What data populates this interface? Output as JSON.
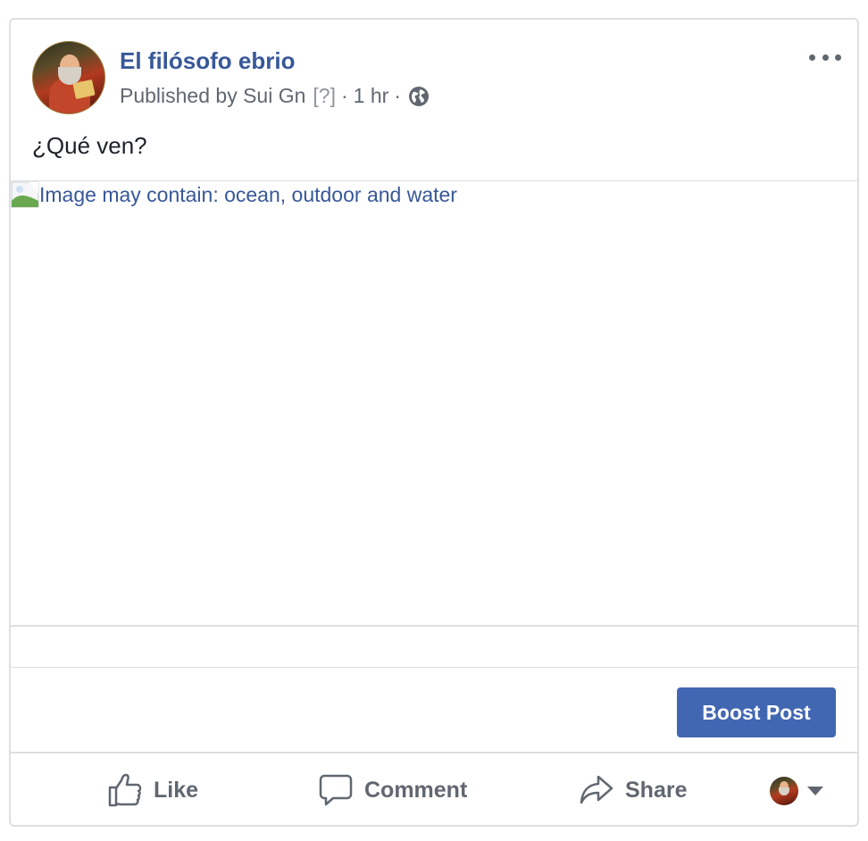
{
  "post": {
    "page_name": "El filósofo ebrio",
    "published_by": "Published by Sui Gn",
    "help_marker": "[?]",
    "separator": "·",
    "time": "1 hr",
    "text": "¿Qué ven?",
    "image_alt": "Image may contain: ocean, outdoor and water"
  },
  "boost": {
    "label": "Boost Post"
  },
  "actions": {
    "like": "Like",
    "comment": "Comment",
    "share": "Share"
  },
  "colors": {
    "link": "#385898",
    "primary": "#4267b2",
    "secondary_text": "#606770",
    "border": "#dddfe2"
  },
  "icons": {
    "privacy": "globe-icon",
    "options": "more-icon",
    "like": "thumbs-up-icon",
    "comment": "speech-bubble-icon",
    "share": "share-arrow-icon",
    "audience": "caret-down-icon"
  }
}
